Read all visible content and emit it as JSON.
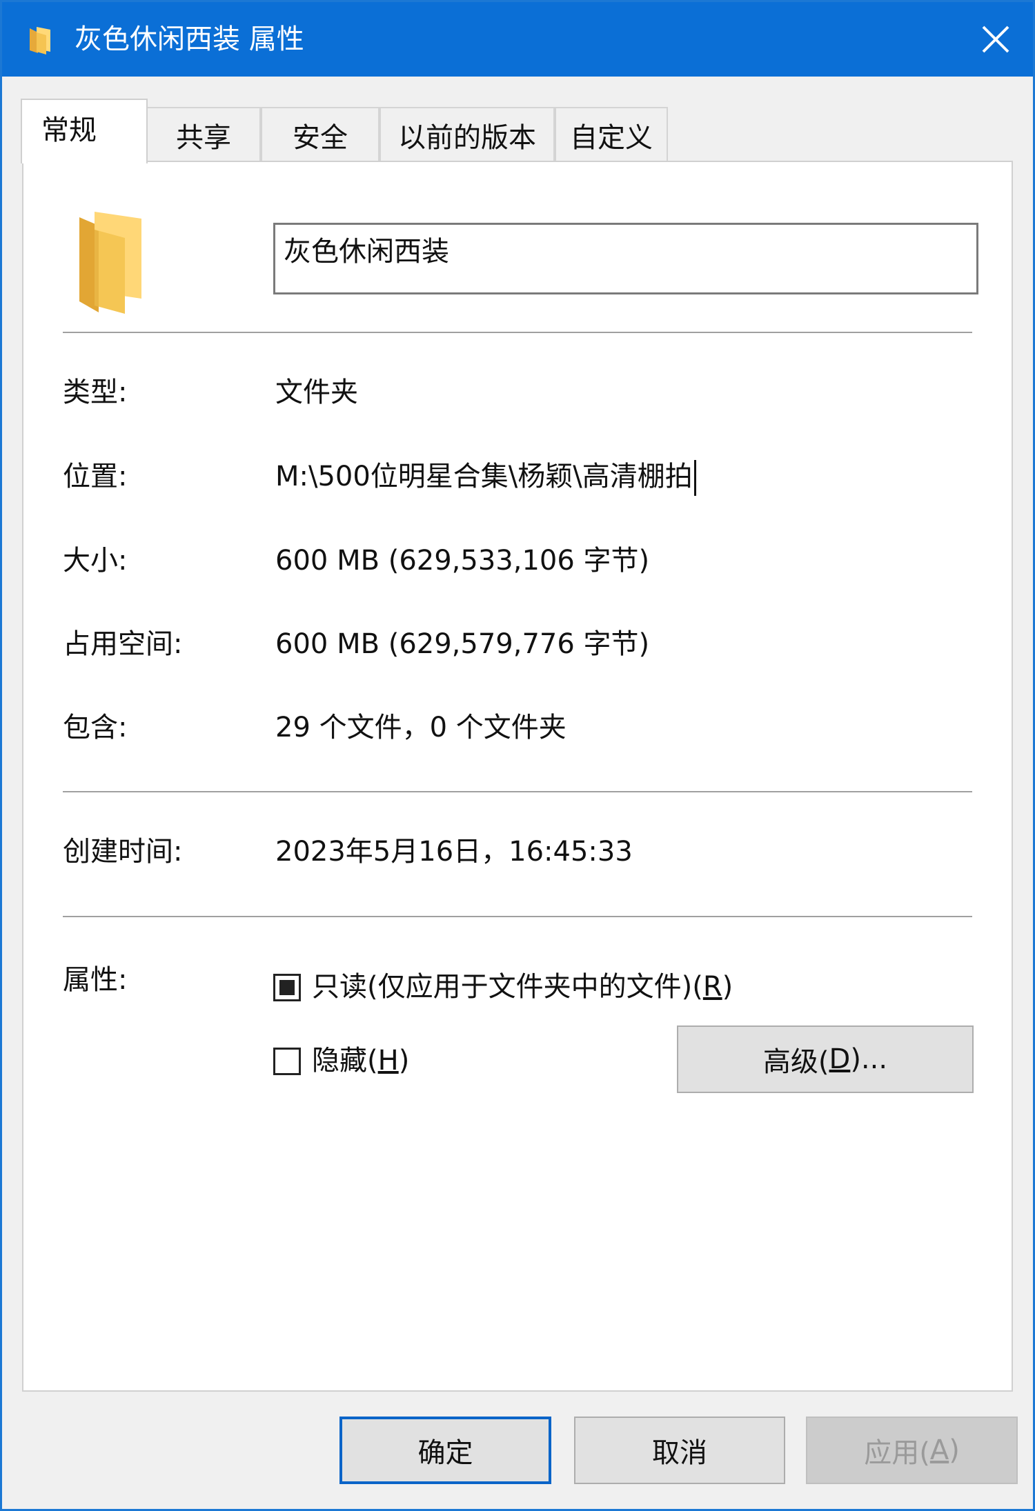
{
  "window": {
    "title": "灰色休闲西装 属性",
    "title_icon": "folder-icon",
    "close_icon": "close-icon"
  },
  "tabs": [
    {
      "label": "常规",
      "active": true
    },
    {
      "label": "共享",
      "active": false
    },
    {
      "label": "安全",
      "active": false
    },
    {
      "label": "以前的版本",
      "active": false
    },
    {
      "label": "自定义",
      "active": false
    }
  ],
  "general": {
    "folder_icon": "folder-icon",
    "name_value": "灰色休闲西装",
    "type_label": "类型:",
    "type_value": "文件夹",
    "location_label": "位置:",
    "location_value": "M:\\500位明星合集\\杨颖\\高清棚拍",
    "size_label": "大小:",
    "size_value": "600 MB (629,533,106 字节)",
    "size_on_disk_label": "占用空间:",
    "size_on_disk_value": "600 MB (629,579,776 字节)",
    "contains_label": "包含:",
    "contains_value": "29 个文件，0 个文件夹",
    "created_label": "创建时间:",
    "created_value": "2023年5月16日，16:45:33",
    "attributes_label": "属性:",
    "readonly_prefix": "只读(仅应用于文件夹中的文件)(",
    "readonly_key": "R",
    "readonly_suffix": ")",
    "readonly_state": "indeterminate",
    "hidden_prefix": "隐藏(",
    "hidden_key": "H",
    "hidden_suffix": ")",
    "hidden_state": "unchecked",
    "advanced_prefix": "高级(",
    "advanced_key": "D",
    "advanced_suffix": ")..."
  },
  "footer": {
    "ok_label": "确定",
    "cancel_label": "取消",
    "apply_prefix": "应用(",
    "apply_key": "A",
    "apply_suffix": ")"
  },
  "colors": {
    "titlebar": "#0b6fd6",
    "default_button_border": "#0a64c8",
    "folder_yellow": "#f2c55c"
  }
}
